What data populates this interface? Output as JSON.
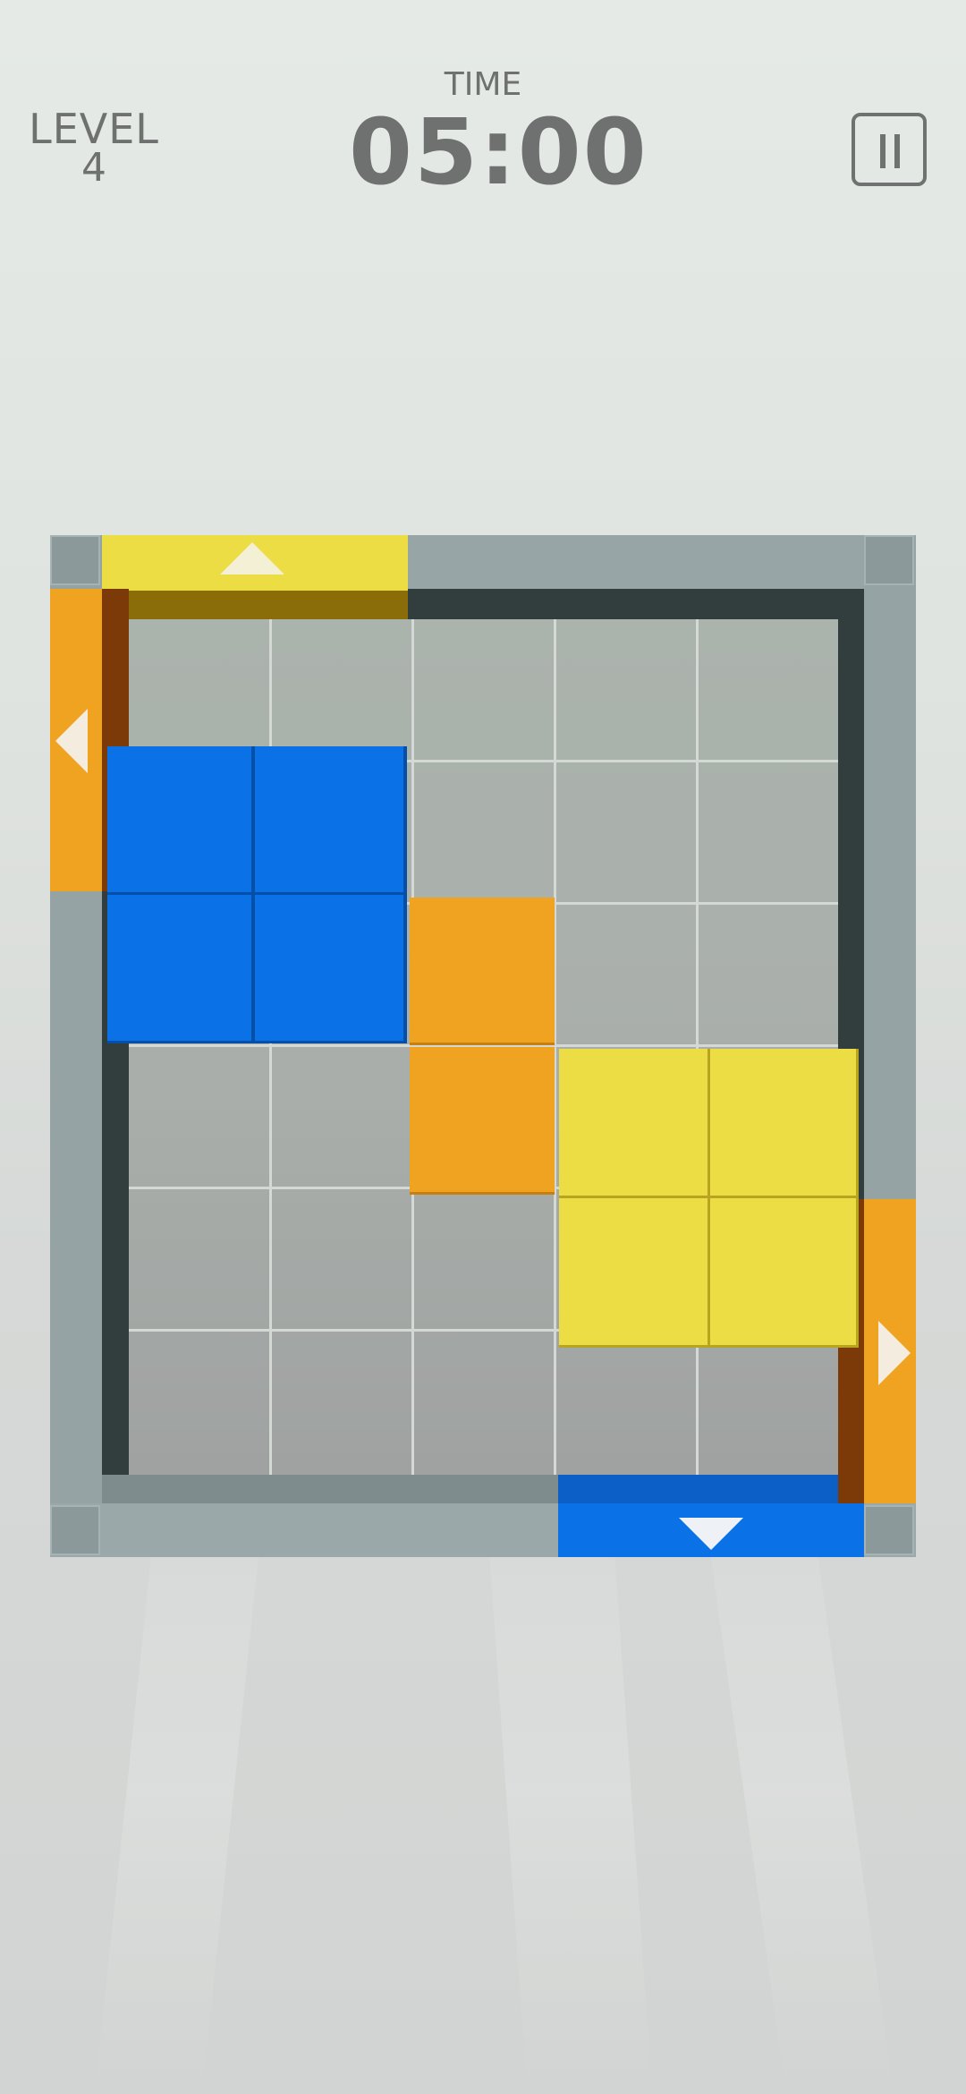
{
  "hud": {
    "level_label": "LEVEL",
    "level_number": "4",
    "time_label": "TIME",
    "time_value": "05:00",
    "pause_icon": "pause-icon"
  },
  "board": {
    "rows": 6,
    "columns": 5,
    "blocks": [
      {
        "color": "blue",
        "cells": [
          [
            1,
            0
          ],
          [
            1,
            1
          ],
          [
            2,
            0
          ],
          [
            2,
            1
          ]
        ]
      },
      {
        "color": "orange",
        "cells": [
          [
            2,
            2
          ],
          [
            3,
            2
          ]
        ]
      },
      {
        "color": "yellow",
        "cells": [
          [
            3,
            3
          ],
          [
            3,
            4
          ],
          [
            4,
            3
          ],
          [
            4,
            4
          ]
        ]
      }
    ],
    "exits": [
      {
        "side": "top",
        "color": "yellow",
        "arrow": "up-arrow-icon"
      },
      {
        "side": "left",
        "color": "orange",
        "arrow": "left-arrow-icon"
      },
      {
        "side": "right",
        "color": "orange",
        "arrow": "right-arrow-icon"
      },
      {
        "side": "bottom",
        "color": "blue",
        "arrow": "down-arrow-icon"
      }
    ]
  },
  "colors": {
    "blue": "#0a72e6",
    "orange": "#f0a321",
    "yellow": "#ecdd45",
    "frame": "#97a5a6",
    "hud_text": "#6f7070"
  }
}
